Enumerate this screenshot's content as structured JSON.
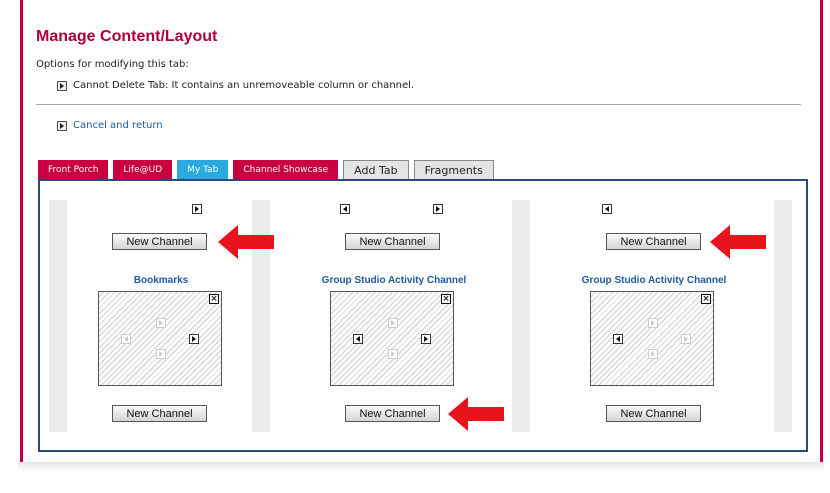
{
  "page": {
    "title": "Manage Content/Layout",
    "options_heading": "Options for modifying this tab:",
    "cannot_delete": "Cannot Delete Tab: It contains an unremoveable column or channel.",
    "cancel_link": "Cancel and return"
  },
  "tabs": [
    {
      "label": "Front Porch"
    },
    {
      "label": "Life@UD"
    },
    {
      "label": "My Tab"
    },
    {
      "label": "Channel Showcase"
    },
    {
      "label": "Add Tab"
    },
    {
      "label": "Fragments"
    }
  ],
  "columns": [
    {
      "new_channel_top": "New Channel",
      "channel_title": "Bookmarks",
      "new_channel_bottom": "New Channel"
    },
    {
      "new_channel_top": "New Channel",
      "channel_title": "Group Studio Activity Channel",
      "new_channel_bottom": "New Channel"
    },
    {
      "new_channel_top": "New Channel",
      "channel_title": "Group Studio Activity Channel",
      "new_channel_bottom": "New Channel"
    }
  ],
  "icons": {
    "close": "x-icon",
    "move": "arrow-icon",
    "annotation": "red-arrow-icon"
  },
  "colors": {
    "brand": "#c8003f",
    "active_tab": "#2aa9e0",
    "link": "#1e5a9c",
    "annotation": "#e8131b"
  }
}
